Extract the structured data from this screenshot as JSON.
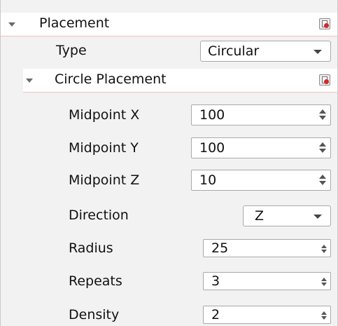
{
  "placement": {
    "title": "Placement",
    "type": {
      "label": "Type",
      "value": "Circular"
    },
    "circle": {
      "title": "Circle Placement",
      "midpoint_x": {
        "label": "Midpoint X",
        "value": "100"
      },
      "midpoint_y": {
        "label": "Midpoint Y",
        "value": "100"
      },
      "midpoint_z": {
        "label": "Midpoint Z",
        "value": "10"
      },
      "direction": {
        "label": "Direction",
        "value": "Z"
      },
      "radius": {
        "label": "Radius",
        "value": "25"
      },
      "repeats": {
        "label": "Repeats",
        "value": "3"
      },
      "density": {
        "label": "Density",
        "value": "2"
      }
    }
  },
  "icons": {
    "expand": "triangle-down-icon",
    "reset": "reset-defaults-icon",
    "dropdown": "chevron-down-icon",
    "spin": "spin-arrows-icon"
  },
  "colors": {
    "header_underline": "#f0c2c2",
    "reset_dot": "#d62828",
    "panel_bg": "#f2f2f2"
  }
}
